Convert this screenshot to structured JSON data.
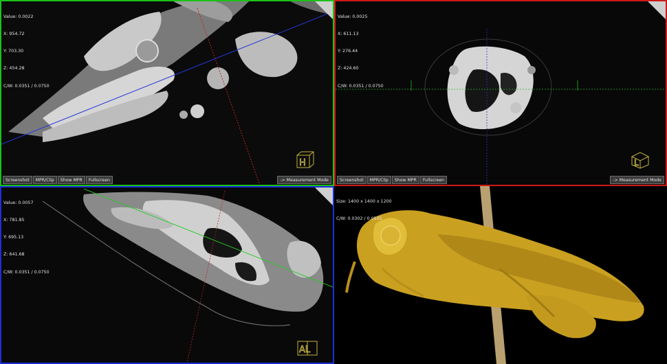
{
  "toolbar": {
    "screenshot": "Screenshot",
    "mpr_clip": "MPR/Clip",
    "show_mpr": "Show MPR",
    "fullscreen": "Fullscreen",
    "measurement_mode": "-> Measurement Mode"
  },
  "viewports": {
    "top_left": {
      "info": [
        "Value: 0.0022",
        "X: 954.72",
        "Y: 703.30",
        "Z: 454.28",
        "C/W: 0.0351 / 0.0750"
      ],
      "orientation_label": "H",
      "border_color": "#19c219"
    },
    "top_right": {
      "info": [
        "Value: 0.0025",
        "X: 611.13",
        "Y: 276.44",
        "Z: 424.60",
        "C/W: 0.0351 / 0.0750"
      ],
      "orientation_label": "L",
      "border_color": "#d01818"
    },
    "bottom_left": {
      "info": [
        "Value: 0.0057",
        "X: 781.85",
        "Y: 695.13",
        "Z: 641.68",
        "C/W: 0.0351 / 0.0750"
      ],
      "orientation_label": "AL",
      "border_color": "#1a2fd8"
    },
    "bottom_right": {
      "info": [
        "Size: 1400 x 1400 x 1200",
        "C/W: 0.0302 / 0.0535"
      ]
    }
  }
}
